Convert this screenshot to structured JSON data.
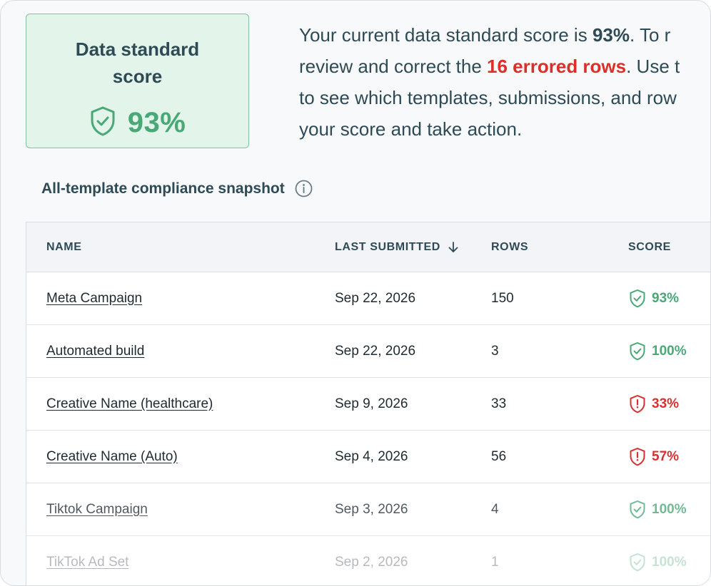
{
  "score_card": {
    "title": "Data standard score",
    "value": "93%"
  },
  "summary": {
    "line1_prefix": "Your current data standard score is ",
    "line1_score": "93%",
    "line1_suffix": ". To r",
    "line2_prefix": "review and correct the ",
    "line2_errors": "16 errored rows",
    "line2_suffix": ". Use t",
    "line3": "to see which templates, submissions, and row",
    "line4": "your score and take action."
  },
  "snapshot": {
    "title": "All-template compliance snapshot"
  },
  "table": {
    "columns": {
      "name": "NAME",
      "last_submitted": "LAST SUBMITTED",
      "rows": "ROWS",
      "score": "SCORE"
    },
    "rows": [
      {
        "name": "Meta Campaign",
        "date": "Sep 22, 2026",
        "rows": "150",
        "score": "93%",
        "status": "good"
      },
      {
        "name": "Automated build",
        "date": "Sep 22, 2026",
        "rows": "3",
        "score": "100%",
        "status": "good"
      },
      {
        "name": "Creative Name (healthcare)",
        "date": "Sep 9, 2026",
        "rows": "33",
        "score": "33%",
        "status": "bad"
      },
      {
        "name": "Creative Name (Auto)",
        "date": "Sep 4, 2026",
        "rows": "56",
        "score": "57%",
        "status": "bad"
      },
      {
        "name": "Tiktok Campaign",
        "date": "Sep 3, 2026",
        "rows": "4",
        "score": "100%",
        "status": "good"
      },
      {
        "name": "TikTok Ad Set",
        "date": "Sep 2, 2026",
        "rows": "1",
        "score": "100%",
        "status": "good"
      }
    ]
  },
  "colors": {
    "good": "#4aa877",
    "bad": "#d93030",
    "text": "#2e4a55",
    "card_bg": "#e3f4ea"
  },
  "icons": {
    "score_card": "shield-check-icon",
    "info": "info-icon",
    "sort": "arrow-down-icon",
    "row_good": "shield-check-icon",
    "row_bad": "shield-alert-icon"
  }
}
